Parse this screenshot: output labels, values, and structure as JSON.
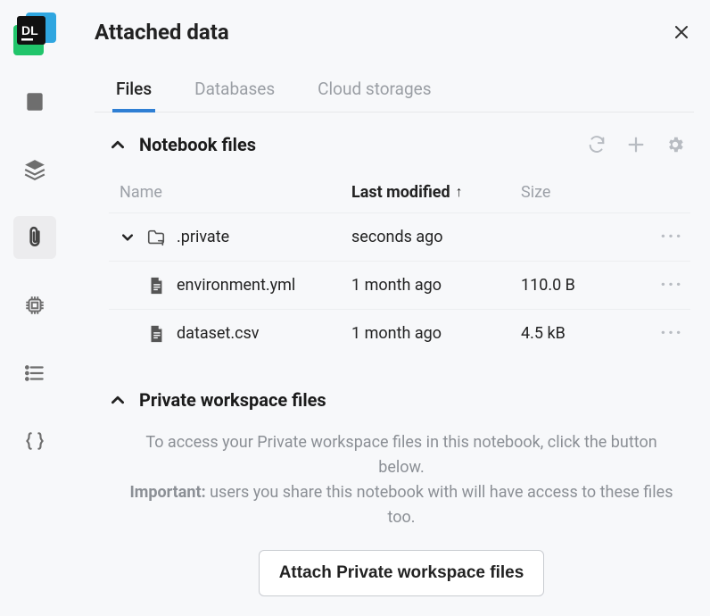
{
  "title": "Attached data",
  "tabs": [
    {
      "label": "Files",
      "active": true
    },
    {
      "label": "Databases",
      "active": false
    },
    {
      "label": "Cloud storages",
      "active": false
    }
  ],
  "notebook_section": {
    "title": "Notebook files",
    "columns": {
      "name": "Name",
      "last_modified": "Last modified",
      "size": "Size"
    },
    "rows": [
      {
        "name": ".private",
        "type": "folder",
        "expandable": true,
        "last_modified": "seconds ago",
        "size": ""
      },
      {
        "name": "environment.yml",
        "type": "file",
        "expandable": false,
        "last_modified": "1 month ago",
        "size": "110.0 B"
      },
      {
        "name": "dataset.csv",
        "type": "file",
        "expandable": false,
        "last_modified": "1 month ago",
        "size": "4.5 kB"
      }
    ]
  },
  "private_section": {
    "title": "Private workspace files",
    "message_line1": "To access your Private workspace files in this notebook, click the button below.",
    "important_label": "Important:",
    "message_line2": " users you share this notebook with will have access to these files too.",
    "button_label": "Attach Private workspace files"
  }
}
